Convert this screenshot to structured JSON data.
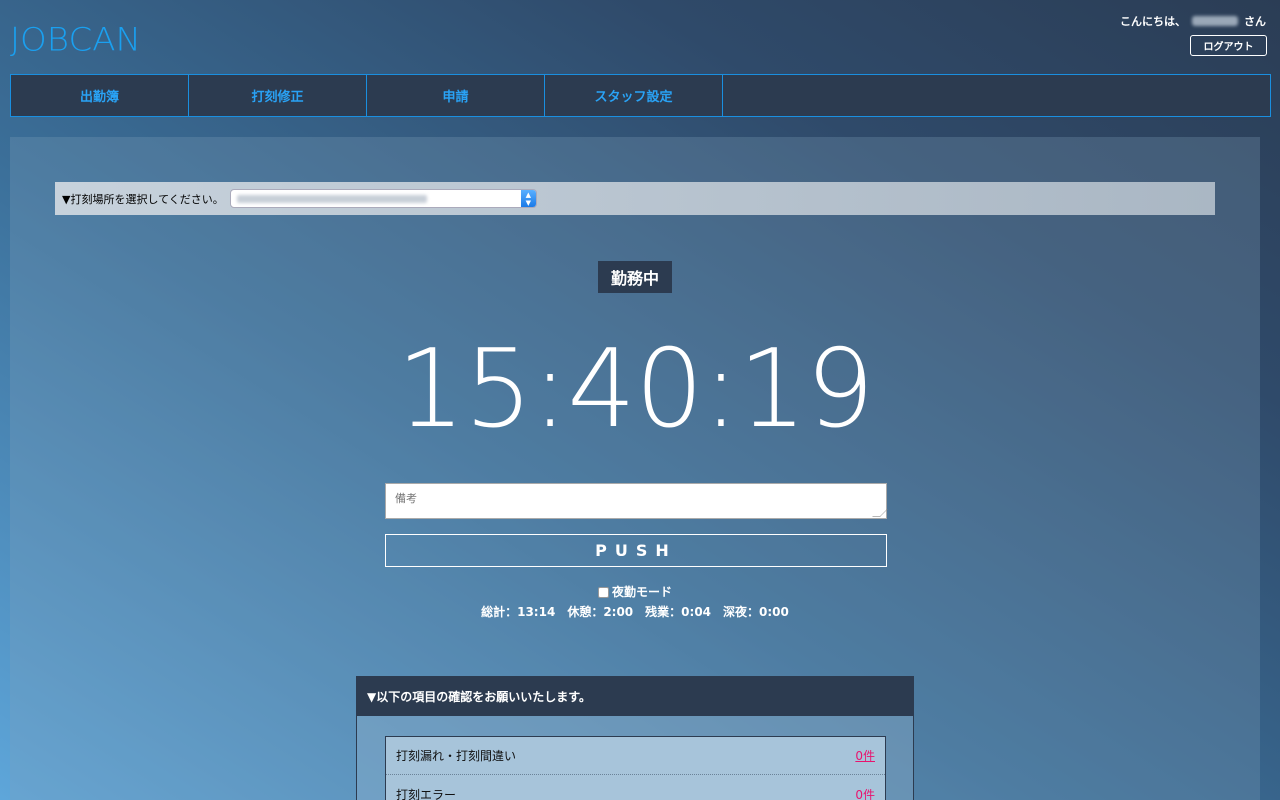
{
  "header": {
    "logo": "JOBCAN",
    "greeting_prefix": "こんにちは、",
    "greeting_suffix": "さん",
    "logout_label": "ログアウト"
  },
  "nav": {
    "items": [
      {
        "label": "出勤簿"
      },
      {
        "label": "打刻修正"
      },
      {
        "label": "申請"
      },
      {
        "label": "スタッフ設定"
      }
    ]
  },
  "location": {
    "label": "▼打刻場所を選択してください。"
  },
  "status": {
    "badge": "勤務中"
  },
  "clock": {
    "time": "15:40:19"
  },
  "note": {
    "placeholder": "備考"
  },
  "push": {
    "label": "PUSH"
  },
  "night_mode": {
    "label": "夜勤モード",
    "checked": false
  },
  "summary": {
    "total": "総計：13:14",
    "break": "休憩：2:00",
    "overtime": "残業：0:04",
    "late_night": "深夜：0:00"
  },
  "confirm": {
    "title": "▼以下の項目の確認をお願いいたします。",
    "rows": [
      {
        "label": "打刻漏れ・打刻間違い",
        "count": "0件"
      },
      {
        "label": "打刻エラー",
        "count": "0件"
      }
    ]
  },
  "colors": {
    "accent": "#1aa0f0",
    "nav_bg": "#2c3b50",
    "count_link": "#e8136e"
  }
}
